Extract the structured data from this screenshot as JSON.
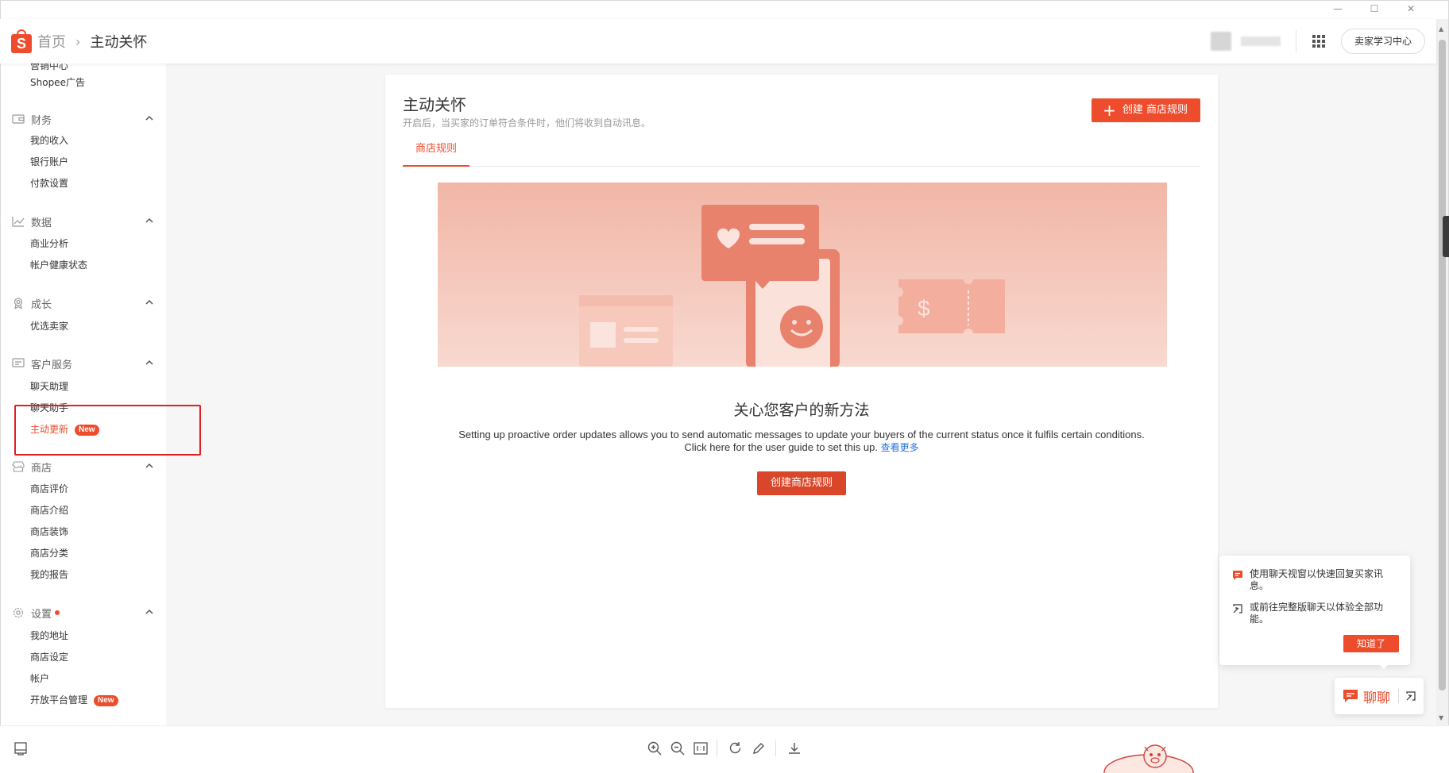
{
  "window": {
    "controls": [
      "minimize",
      "maximize",
      "close"
    ]
  },
  "header": {
    "logo_letter": "S",
    "breadcrumb_home": "首页",
    "breadcrumb_sep": "›",
    "breadcrumb_current": "主动关怀",
    "learn_button": "卖家学习中心"
  },
  "sidebar": {
    "top_cut": "营销中心",
    "top_item": "Shopee广告",
    "finance": {
      "label": "财务",
      "items": [
        "我的收入",
        "银行账户",
        "付款设置"
      ]
    },
    "data": {
      "label": "数据",
      "items": [
        "商业分析",
        "帐户健康状态"
      ]
    },
    "growth": {
      "label": "成长",
      "items": [
        "优选卖家"
      ]
    },
    "service": {
      "label": "客户服务",
      "items": [
        "聊天助理",
        "聊天助手",
        "主动更新"
      ],
      "new_badge": "New"
    },
    "shop": {
      "label": "商店",
      "items": [
        "商店评价",
        "商店介绍",
        "商店装饰",
        "商店分类",
        "我的报告"
      ]
    },
    "settings": {
      "label": "设置",
      "items": [
        "我的地址",
        "商店设定",
        "帐户",
        "开放平台管理"
      ],
      "new_badge": "New"
    }
  },
  "main": {
    "title": "主动关怀",
    "subtitle": "开启后，当买家的订单符合条件时，他们将收到自动讯息。",
    "create_top_button": "创建 商店规则",
    "tab": "商店规则",
    "empty_title": "关心您客户的新方法",
    "empty_desc_line1": "Setting up proactive order updates allows you to send automatic messages to update your buyers of the current status once it fulfils certain conditions.",
    "empty_desc_line2": "Click here for the user guide to set this up.",
    "learn_more": "查看更多",
    "create_center_button": "创建商店规则"
  },
  "chat_tip": {
    "line1": "使用聊天视窗以快速回复买家讯息。",
    "line2": "或前往完整版聊天以体验全部功能。",
    "got_it": "知道了"
  },
  "chat_button": {
    "label": "聊聊"
  },
  "colors": {
    "brand": "#ee4d2d",
    "link": "#2673dd",
    "highlight_box": "#e02020"
  },
  "icons": [
    "shopee-logo-icon",
    "apps-grid-icon",
    "bell-icon",
    "wallet-icon",
    "chart-icon",
    "medal-icon",
    "service-icon",
    "shop-icon",
    "gear-icon",
    "chevron-up-icon",
    "chat-icon",
    "external-window-icon",
    "zoom-in-icon",
    "zoom-out-icon",
    "actual-size-icon",
    "rotate-icon",
    "edit-icon",
    "download-icon",
    "panel-icon"
  ]
}
